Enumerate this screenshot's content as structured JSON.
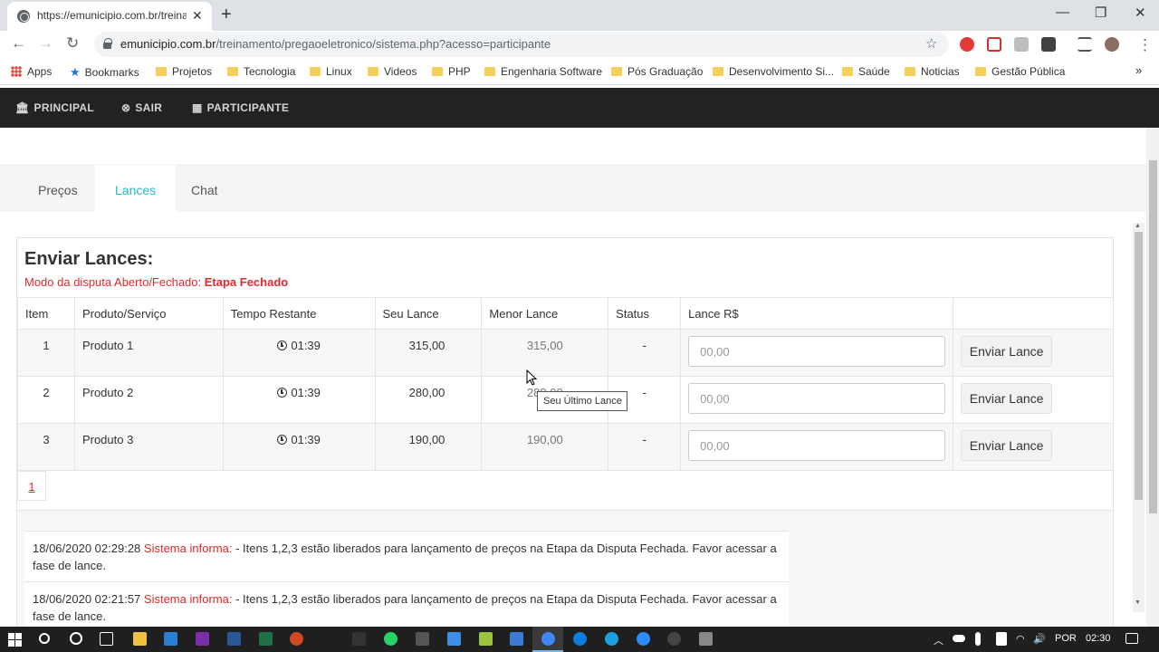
{
  "browser": {
    "tab_title": "https://emunicipio.com.br/treina",
    "url_domain": "emunicipio.com.br",
    "url_path": "/treinamento/pregaoeletronico/sistema.php?acesso=participante",
    "bookmarks": [
      {
        "label": "Apps",
        "icon": "apps-grid-icon"
      },
      {
        "label": "Bookmarks",
        "icon": "star-icon"
      },
      {
        "label": "Projetos",
        "icon": "folder-icon"
      },
      {
        "label": "Tecnologia",
        "icon": "folder-icon"
      },
      {
        "label": "Linux",
        "icon": "folder-icon"
      },
      {
        "label": "Videos",
        "icon": "folder-icon"
      },
      {
        "label": "PHP",
        "icon": "folder-icon"
      },
      {
        "label": "Engenharia Software",
        "icon": "folder-icon"
      },
      {
        "label": "Pós Graduação",
        "icon": "folder-icon"
      },
      {
        "label": "Desenvolvimento Si...",
        "icon": "folder-icon"
      },
      {
        "label": "Saúde",
        "icon": "folder-icon"
      },
      {
        "label": "Noticias",
        "icon": "folder-icon"
      },
      {
        "label": "Gestão Pública",
        "icon": "folder-icon"
      }
    ]
  },
  "navbar": {
    "principal": "PRINCIPAL",
    "sair": "SAIR",
    "participante": "PARTICIPANTE"
  },
  "tabs": [
    "Preços",
    "Lances",
    "Chat"
  ],
  "active_tab": "Lances",
  "panel": {
    "title": "Enviar Lances:",
    "mode_label": "Modo da disputa Aberto/Fechado: ",
    "mode_value": "Etapa Fechado"
  },
  "table": {
    "headers": [
      "Item",
      "Produto/Serviço",
      "Tempo Restante",
      "Seu Lance",
      "Menor Lance",
      "Status",
      "Lance R$",
      ""
    ],
    "rows": [
      {
        "item": "1",
        "produto": "Produto 1",
        "tempo": "01:39",
        "seu_lance": "315,00",
        "menor_lance": "315,00",
        "status": "-",
        "placeholder": "00,00",
        "button": "Enviar Lance"
      },
      {
        "item": "2",
        "produto": "Produto 2",
        "tempo": "01:39",
        "seu_lance": "280,00",
        "menor_lance": "280,00",
        "status": "-",
        "placeholder": "00,00",
        "button": "Enviar Lance"
      },
      {
        "item": "3",
        "produto": "Produto 3",
        "tempo": "01:39",
        "seu_lance": "190,00",
        "menor_lance": "190,00",
        "status": "-",
        "placeholder": "00,00",
        "button": "Enviar Lance"
      }
    ]
  },
  "pager": {
    "current": "1"
  },
  "tooltip": "Seu Último Lance",
  "log": [
    {
      "timestamp": "18/06/2020 02:29:28",
      "sender": "Sistema informa:",
      "message": " - Itens 1,2,3 estão liberados para lançamento de preços na Etapa da Disputa Fechada. Favor acessar a fase de lance."
    },
    {
      "timestamp": "18/06/2020 02:21:57",
      "sender": "Sistema informa:",
      "message": " - Itens 1,2,3 estão liberados para lançamento de preços na Etapa da Disputa Fechada. Favor acessar a fase de lance."
    }
  ],
  "taskbar": {
    "language": "POR",
    "time": "02:30"
  },
  "colors": {
    "accent": "#2bb6c9",
    "alert": "#e3282e",
    "navbar_bg": "#222222"
  }
}
